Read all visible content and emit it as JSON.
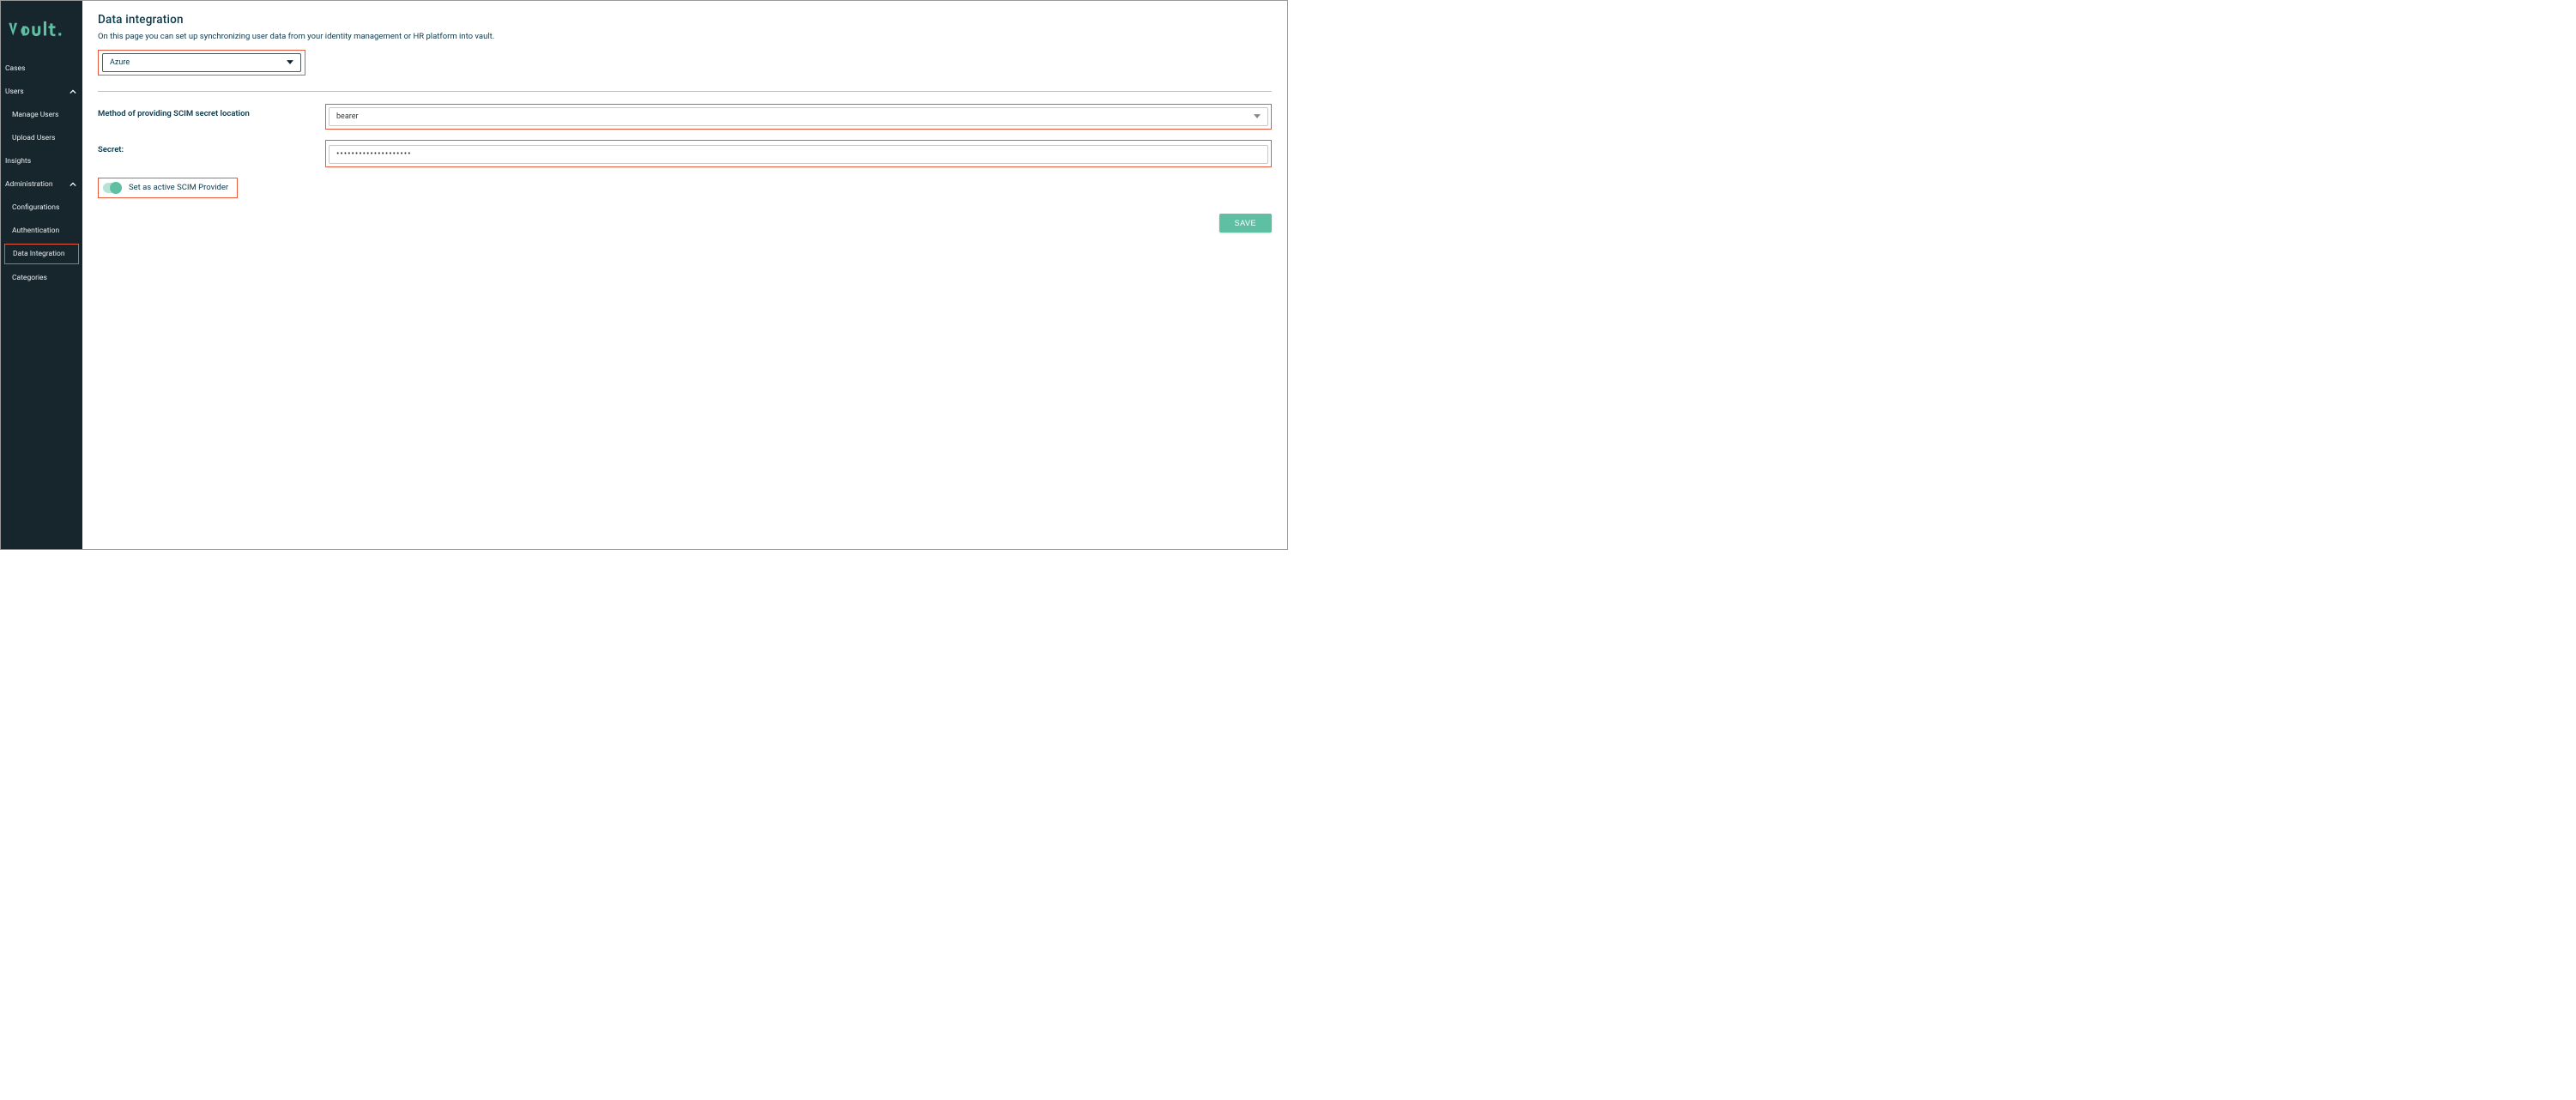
{
  "brand": {
    "name": "vault."
  },
  "sidebar": {
    "items": [
      {
        "label": "Cases",
        "type": "link"
      },
      {
        "label": "Users",
        "type": "group",
        "expanded": true
      },
      {
        "label": "Manage Users",
        "type": "sub"
      },
      {
        "label": "Upload Users",
        "type": "sub"
      },
      {
        "label": "Insights",
        "type": "link"
      },
      {
        "label": "Administration",
        "type": "group",
        "expanded": true
      },
      {
        "label": "Configurations",
        "type": "sub"
      },
      {
        "label": "Authentication",
        "type": "sub"
      },
      {
        "label": "Data Integration",
        "type": "sub",
        "active": true
      },
      {
        "label": "Categories",
        "type": "sub"
      }
    ]
  },
  "main": {
    "title": "Data integration",
    "description": "On this page you can set up synchronizing user data from your identity management or HR platform into vault.",
    "provider_select": {
      "value": "Azure"
    },
    "method_label": "Method of providing SCIM secret location",
    "method_select": {
      "value": "bearer"
    },
    "secret_label": "Secret:",
    "secret_value": "••••••••••••••••••••",
    "toggle_label": "Set as active SCIM Provider",
    "toggle_on": true,
    "save_label": "SAVE"
  },
  "colors": {
    "sidebar_bg": "#17252d",
    "accent": "#5fbfa3",
    "highlight_border": "#e85a3b",
    "text_primary": "#0d3a4a"
  }
}
